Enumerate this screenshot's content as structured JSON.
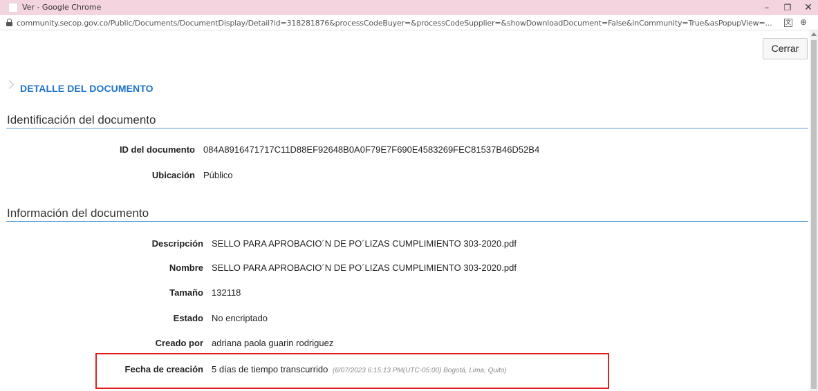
{
  "window": {
    "title": "Ver - Google Chrome",
    "minimize": "–",
    "maximize": "❐",
    "close": "✕"
  },
  "address_bar": {
    "url": "community.secop.gov.co/Public/Documents/DocumentDisplay/Detail?id=318281876&processCodeBuyer=&processCodeSupplier=&showDownloadDocument=False&inCommunity=True&asPopupView=..."
  },
  "toolbar": {
    "close_label": "Cerrar"
  },
  "page": {
    "heading": "DETALLE DEL DOCUMENTO"
  },
  "identification": {
    "title": "Identificación del documento",
    "fields": [
      {
        "label": "ID del documento",
        "value": "084A8916471717C11D88EF92648B0A0F79E7F690E4583269FEC81537B46D52B4"
      },
      {
        "label": "Ubicación",
        "value": "Público"
      }
    ]
  },
  "information": {
    "title": "Información del documento",
    "fields": [
      {
        "label": "Descripción",
        "value": "SELLO PARA APROBACIO´N DE PO´LIZAS CUMPLIMIENTO 303-2020.pdf"
      },
      {
        "label": "Nombre",
        "value": "SELLO PARA APROBACIO´N DE PO´LIZAS CUMPLIMIENTO 303-2020.pdf"
      },
      {
        "label": "Tamaño",
        "value": "132118"
      },
      {
        "label": "Estado",
        "value": "No encriptado"
      },
      {
        "label": "Creado por",
        "value": "adriana paola guarin rodriguez"
      },
      {
        "label": "Fecha de creación",
        "value": "5 días de tiempo transcurrido",
        "detail": "(6/07/2023 6:15:13 PM(UTC-05:00) Bogotá, Lima, Quito)"
      }
    ]
  },
  "colors": {
    "accent": "#1a73c9",
    "rule": "#5b9bd5",
    "highlight": "#e02020",
    "titlebar": "#f3d4df"
  }
}
